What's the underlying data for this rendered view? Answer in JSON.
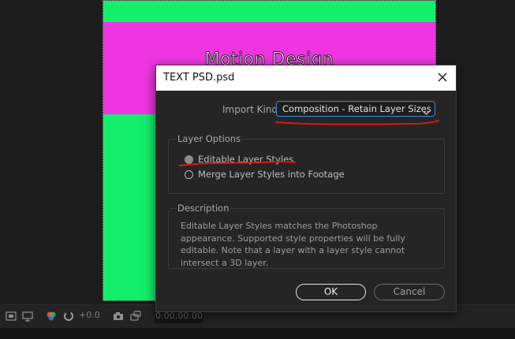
{
  "composition": {
    "text": "Motion Design",
    "colors": {
      "green": "#13ef6a",
      "magenta": "#ef35e2"
    }
  },
  "timeline_bar": {
    "zoom_value": "+0.0",
    "timecode": "0:00:00:00"
  },
  "dialog": {
    "title": "TEXT PSD.psd",
    "import_kind_label": "Import Kind:",
    "import_kind_value": "Composition - Retain Layer Sizes",
    "layer_options": {
      "title": "Layer Options",
      "options": [
        {
          "label": "Editable Layer Styles",
          "selected": true
        },
        {
          "label": "Merge Layer Styles into Footage",
          "selected": false
        }
      ]
    },
    "description": {
      "title": "Description",
      "text": "Editable Layer Styles matches the Photoshop appearance. Supported style properties will be fully editable. Note that a layer with a layer style cannot intersect a 3D layer."
    },
    "ok_label": "OK",
    "cancel_label": "Cancel"
  },
  "icons": [
    "close-icon",
    "chevron-down-icon",
    "color-wheel-icon",
    "refresh-icon",
    "camera-icon",
    "snapshot-icon",
    "monitor-icon"
  ]
}
